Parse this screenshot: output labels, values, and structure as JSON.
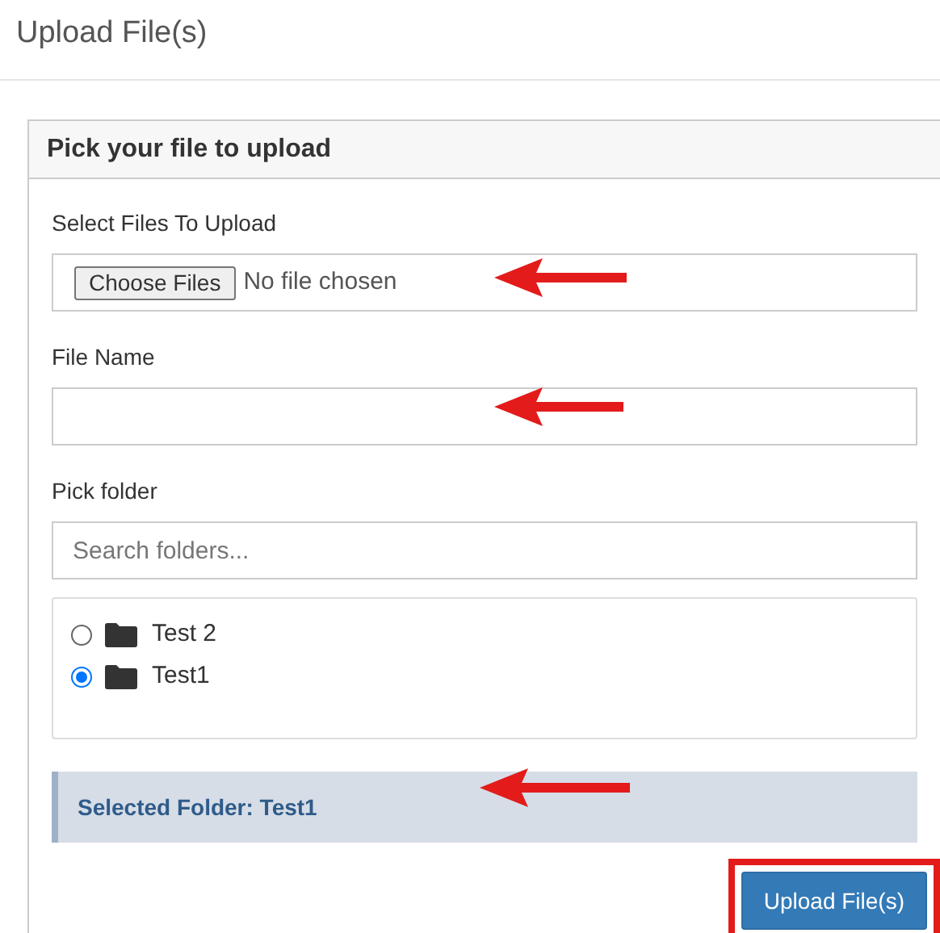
{
  "dialog": {
    "title": "Upload File(s)"
  },
  "panel": {
    "title": "Pick your file to upload",
    "file_picker": {
      "label": "Select Files To Upload",
      "button": "Choose Files",
      "status": "No file chosen"
    },
    "file_name": {
      "label": "File Name"
    },
    "folder_picker": {
      "label": "Pick folder",
      "search": {
        "placeholder": "Search folders..."
      },
      "folders": [
        {
          "name": "Test 2",
          "selected": false
        },
        {
          "name": "Test1",
          "selected": true
        }
      ]
    },
    "selected_folder": "Selected Folder: Test1",
    "submit": "Upload File(s)"
  }
}
